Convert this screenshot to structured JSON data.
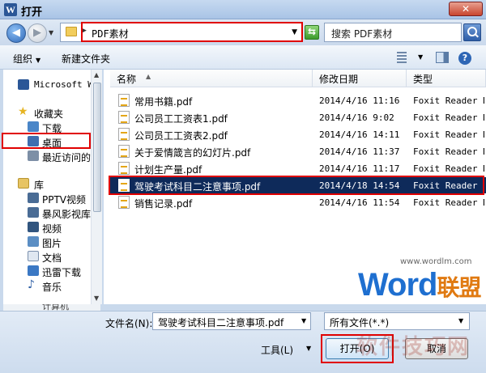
{
  "window": {
    "title": "打开",
    "app_icon": "W",
    "close_glyph": "✕"
  },
  "address": {
    "path": "PDF素材",
    "search_placeholder": "搜索 PDF素材",
    "back_glyph": "◀",
    "forward_glyph": "▶",
    "refresh_glyph": "⇆"
  },
  "toolbar": {
    "organize": "组织",
    "new_folder": "新建文件夹",
    "help_glyph": "?"
  },
  "nav": {
    "items": [
      {
        "label": "Microsoft Wo",
        "icon": "word-icon"
      },
      {
        "label": "收藏夹",
        "icon": "star-icon"
      },
      {
        "label": "下载",
        "icon": "download-folder-icon"
      },
      {
        "label": "桌面",
        "icon": "desktop-icon"
      },
      {
        "label": "最近访问的",
        "icon": "recent-places-icon"
      },
      {
        "label": "库",
        "icon": "library-icon"
      },
      {
        "label": "PPTV视频",
        "icon": "video-library-icon"
      },
      {
        "label": "暴风影视库",
        "icon": "video-library-icon"
      },
      {
        "label": "视频",
        "icon": "video-icon"
      },
      {
        "label": "图片",
        "icon": "pictures-icon"
      },
      {
        "label": "文档",
        "icon": "documents-icon"
      },
      {
        "label": "迅雷下载",
        "icon": "thunder-download-icon"
      },
      {
        "label": "音乐",
        "icon": "music-icon"
      }
    ],
    "cut_off_label": "计算机"
  },
  "columns": {
    "name": "名称",
    "date": "修改日期",
    "type": "类型"
  },
  "files": [
    {
      "name": "常用书籍.pdf",
      "date": "2014/4/16 11:16",
      "type": "Foxit Reader D..."
    },
    {
      "name": "公司员工工资表1.pdf",
      "date": "2014/4/16 9:02",
      "type": "Foxit Reader D..."
    },
    {
      "name": "公司员工工资表2.pdf",
      "date": "2014/4/16 14:11",
      "type": "Foxit Reader D..."
    },
    {
      "name": "关于爱情箴言的幻灯片.pdf",
      "date": "2014/4/16 11:37",
      "type": "Foxit Reader D..."
    },
    {
      "name": "计划生产量.pdf",
      "date": "2014/4/16 11:17",
      "type": "Foxit Reader D..."
    },
    {
      "name": "驾驶考试科目二注意事项.pdf",
      "date": "2014/4/18 14:54",
      "type": "Foxit Reader D...",
      "selected": true
    },
    {
      "name": "销售记录.pdf",
      "date": "2014/4/16 11:54",
      "type": "Foxit Reader D..."
    }
  ],
  "footer": {
    "filename_label": "文件名(N):",
    "filename_value": "驾驶考试科目二注意事项.pdf",
    "filetype_value": "所有文件(*.*)",
    "tools": "工具(L)",
    "open": "打开(O)",
    "cancel": "取消"
  },
  "watermark": {
    "url": "www.wordlm.com",
    "brand": "Word",
    "brand_cn": "联盟",
    "bottom": "软件技巧网"
  },
  "colors": {
    "highlight": "#e00000",
    "selection": "#0e2a5a"
  }
}
